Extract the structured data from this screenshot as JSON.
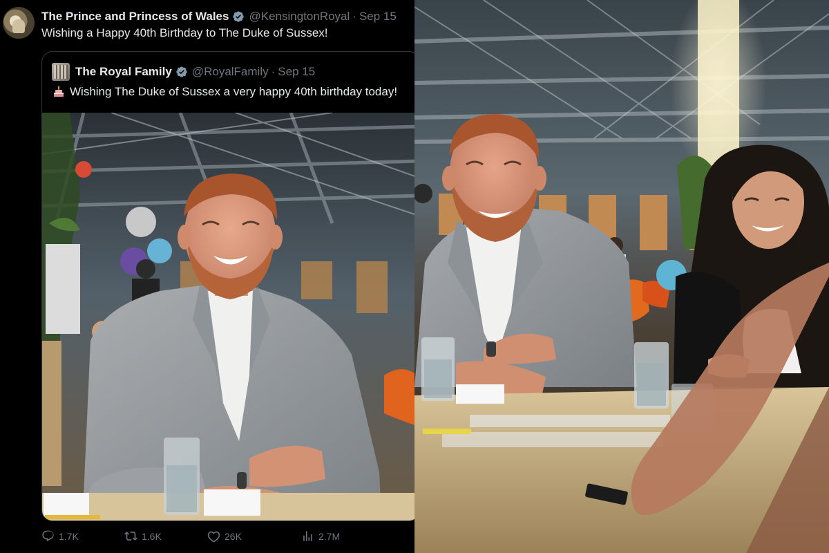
{
  "tweet": {
    "author_name": "The Prince and Princess of Wales",
    "handle": "@KensingtonRoyal",
    "separator": "·",
    "date": "Sep 15",
    "text": "Wishing a Happy 40th Birthday to The Duke of Sussex!",
    "quoted": {
      "author_name": "The Royal Family",
      "handle": "@RoyalFamily",
      "separator": "·",
      "date": "Sep 15",
      "text": "Wishing The Duke of Sussex a very happy 40th birthday today!"
    },
    "actions": {
      "replies": "1.7K",
      "retweets": "1.6K",
      "likes": "26K",
      "views": "2.7M"
    }
  },
  "icons": {
    "verified": "verified-badge-icon",
    "reply": "reply-icon",
    "retweet": "retweet-icon",
    "like": "heart-icon",
    "views": "views-icon",
    "cake": "birthday-cake-icon"
  },
  "colors": {
    "background": "#000000",
    "text_primary": "#e7e9ea",
    "text_secondary": "#71767b",
    "verified": "#829aab",
    "border": "#333639"
  }
}
